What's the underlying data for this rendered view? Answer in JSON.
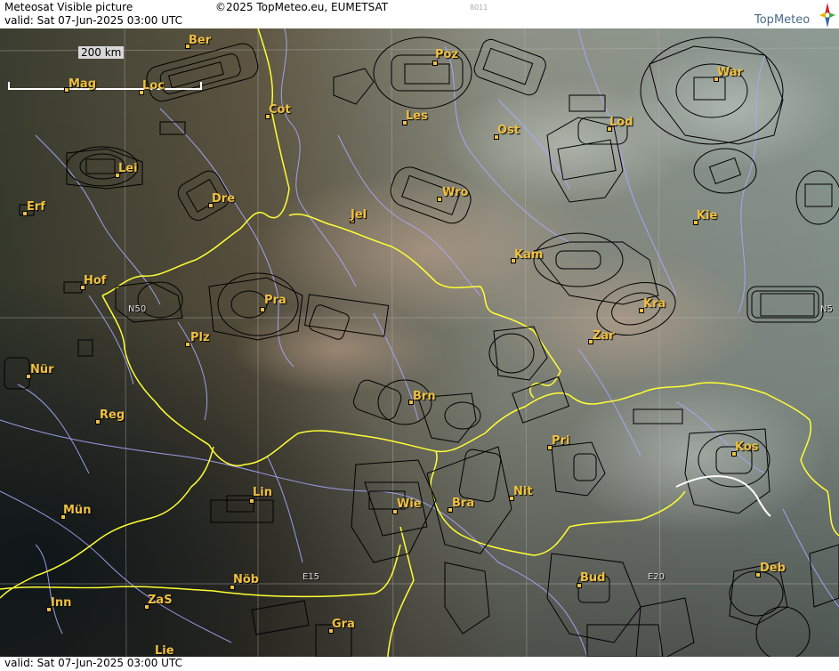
{
  "header": {
    "title": "Meteosat Visible picture",
    "valid": "valid:  Sat  07-Jun-2025  03:00 UTC",
    "copyright": "©2025 TopMeteo.eu, EUMETSAT",
    "code": "8011",
    "logo": "TopMeteo"
  },
  "footer": {
    "valid": "valid:  Sat  07-Jun-2025  03:00 UTC"
  },
  "scale": {
    "label": "200 km"
  },
  "grid_labels": {
    "n50_left": "N50",
    "n50_right": "N5",
    "e15": "E15",
    "e20": "E20"
  },
  "colors": {
    "border": "#ffff33",
    "rivers": "#a9a9ff",
    "labels": "#f0c040",
    "airspace": "#000000"
  },
  "cities": [
    {
      "name": "Ber"
    },
    {
      "name": "Mag"
    },
    {
      "name": "Loc"
    },
    {
      "name": "Cot"
    },
    {
      "name": "Poz"
    },
    {
      "name": "War"
    },
    {
      "name": "Les"
    },
    {
      "name": "Ost"
    },
    {
      "name": "Lod"
    },
    {
      "name": "Lei"
    },
    {
      "name": "Erf"
    },
    {
      "name": "Dre"
    },
    {
      "name": "Wro"
    },
    {
      "name": "Jel"
    },
    {
      "name": "Kie"
    },
    {
      "name": "Kam"
    },
    {
      "name": "Hof"
    },
    {
      "name": "Pra"
    },
    {
      "name": "Kra"
    },
    {
      "name": "Plz"
    },
    {
      "name": "Zar"
    },
    {
      "name": "Nür"
    },
    {
      "name": "Brn"
    },
    {
      "name": "Reg"
    },
    {
      "name": "Pri"
    },
    {
      "name": "Kos"
    },
    {
      "name": "Lin"
    },
    {
      "name": "Nit"
    },
    {
      "name": "Wie"
    },
    {
      "name": "Bra"
    },
    {
      "name": "Mün"
    },
    {
      "name": "Nöb"
    },
    {
      "name": "Bud"
    },
    {
      "name": "Deb"
    },
    {
      "name": "Inn"
    },
    {
      "name": "ZaS"
    },
    {
      "name": "Gra"
    },
    {
      "name": "Lie"
    }
  ]
}
